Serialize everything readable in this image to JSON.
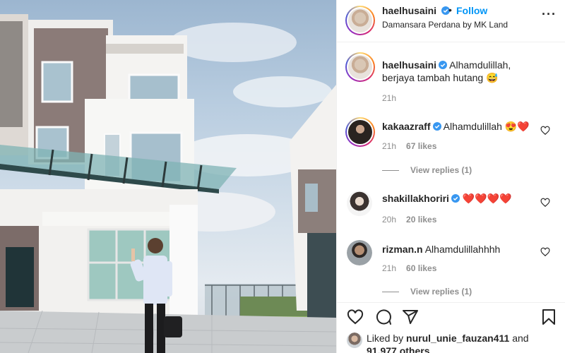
{
  "post": {
    "username": "haelhusaini",
    "follow_label": "Follow",
    "separator": "•",
    "location": "Damansara Perdana by MK Land",
    "more_label": "···"
  },
  "caption": {
    "username": "haelhusaini",
    "text": "Alhamdulillah, berjaya tambah hutang 😅",
    "time": "21h"
  },
  "comments": [
    {
      "username": "kakaazraff",
      "verified": true,
      "text": "Alhamdulillah 😍❤️",
      "time": "21h",
      "likes": "67 likes",
      "view_replies": "View replies (1)"
    },
    {
      "username": "shakillakhoriri",
      "verified": true,
      "text": "❤️❤️❤️❤️",
      "time": "20h",
      "likes": "20 likes"
    },
    {
      "username": "rizman.n",
      "verified": false,
      "text": "Alhamdulillahhhh",
      "time": "21h",
      "likes": "60 likes",
      "view_replies": "View replies (1)"
    }
  ],
  "likes_line": {
    "prefix": "Liked by",
    "user": "nurul_unie_fauzan411",
    "and": "and",
    "others": "91,977 others"
  },
  "colors": {
    "accent": "#0095f6",
    "verified": "#3897f0",
    "text": "#262626",
    "muted": "#8e8e8e"
  },
  "icons": [
    "verified-badge-icon",
    "heart-icon",
    "comment-icon",
    "share-icon",
    "bookmark-icon",
    "more-icon"
  ]
}
